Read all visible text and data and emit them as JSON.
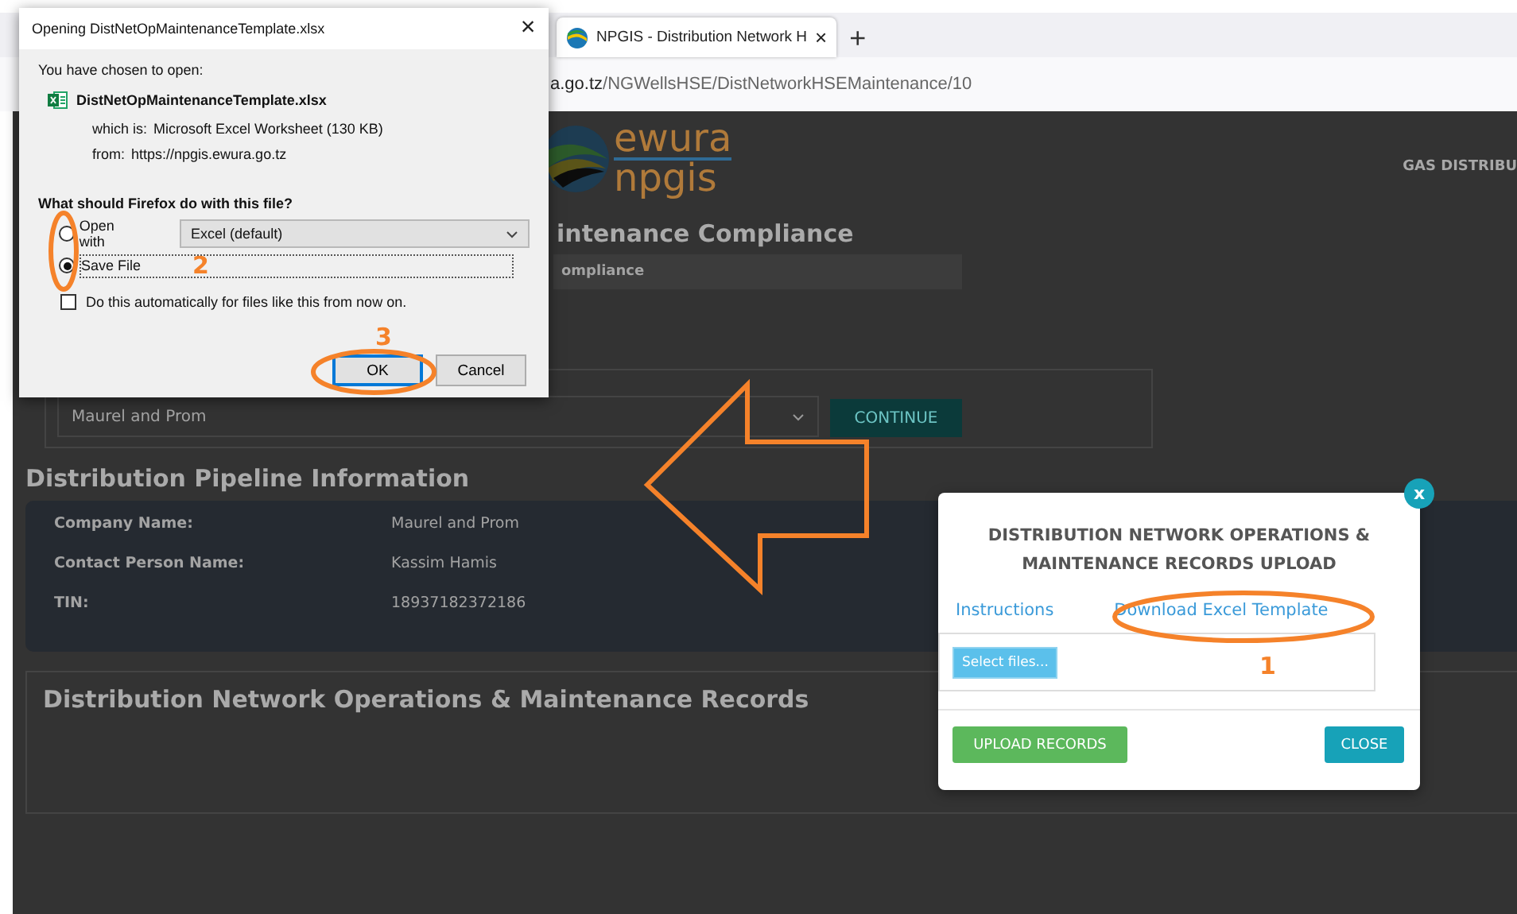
{
  "browser": {
    "tab": {
      "title": "NPGIS - Distribution Network H",
      "close": "×"
    },
    "new_tab": "+",
    "url": {
      "host": "a.go.tz",
      "path": "/NGWellsHSE/DistNetworkHSEMaintenance/10"
    }
  },
  "page": {
    "logo": {
      "top": "ewura",
      "bottom": "npgis"
    },
    "nav_item": "GAS DISTRIBU",
    "heading": "intenance Compliance",
    "breadcrumb": "ompliance",
    "company_select": {
      "value": "Maurel and Prom"
    },
    "continue_button": "CONTINUE",
    "pipeline_section": {
      "title": "Distribution Pipeline Information",
      "fields": [
        {
          "label": "Company Name:",
          "value": "Maurel and Prom"
        },
        {
          "label": "Contact Person Name:",
          "value": "Kassim Hamis"
        },
        {
          "label": "TIN:",
          "value": "18937182372186"
        }
      ]
    },
    "records_section": {
      "title": "Distribution Network Operations & Maintenance Records"
    }
  },
  "download_dialog": {
    "title": "Opening DistNetOpMaintenanceTemplate.xlsx",
    "close": "×",
    "intro": "You have chosen to open:",
    "file_name": "DistNetOpMaintenanceTemplate.xlsx",
    "type_label": "which is:",
    "type_value": "Microsoft Excel Worksheet (130 KB)",
    "from_label": "from:",
    "from_value": "https://npgis.ewura.go.tz",
    "question": "What should Firefox do with this file?",
    "options": [
      {
        "label": "Open with",
        "selected": false
      },
      {
        "label": "Save File",
        "selected": true
      }
    ],
    "app_select": "Excel (default)",
    "auto_checkbox": {
      "label": "Do this automatically for files like this from now on.",
      "checked": false
    },
    "buttons": [
      {
        "label": "OK",
        "default": true
      },
      {
        "label": "Cancel",
        "default": false
      }
    ]
  },
  "upload_modal": {
    "close_badge": "x",
    "title": "DISTRIBUTION NETWORK OPERATIONS & MAINTENANCE RECORDS UPLOAD",
    "links": [
      "Instructions",
      "Download Excel Template"
    ],
    "select_files": "Select files...",
    "upload_button": "UPLOAD RECORDS",
    "close_button": "CLOSE"
  },
  "annotations": {
    "steps": [
      "1",
      "2",
      "3"
    ]
  }
}
